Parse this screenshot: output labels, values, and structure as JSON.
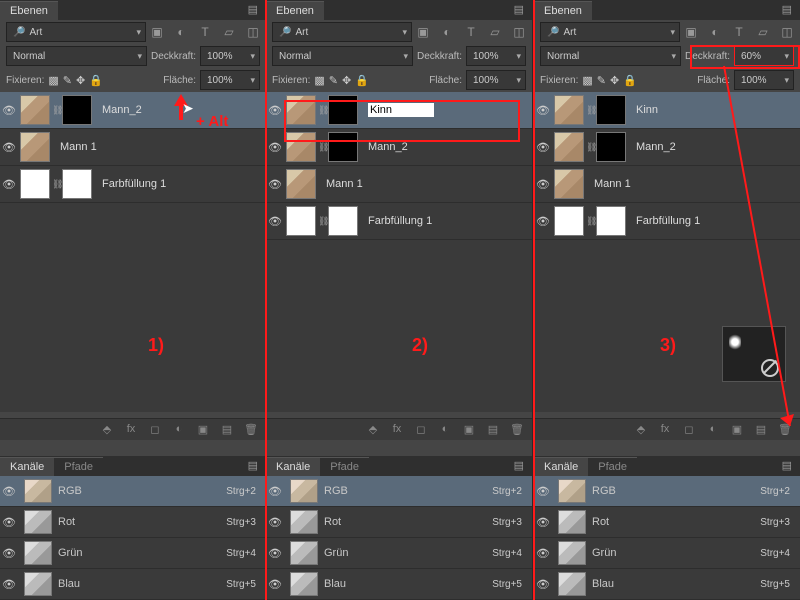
{
  "common": {
    "panelTitle": "Ebenen",
    "filterLabel": "Art",
    "blendMode": "Normal",
    "opacityLabel": "Deckkraft:",
    "fillLabel": "Fläche:",
    "lockLabel": "Fixieren:",
    "pct100": "100%",
    "channelsTab": "Kanäle",
    "pathsTab": "Pfade"
  },
  "panel1": {
    "opacity": "100%",
    "layers": [
      {
        "name": "Mann_2",
        "selected": true,
        "mask": "black"
      },
      {
        "name": "Mann 1",
        "mask": null
      },
      {
        "name": "Farbfüllung 1",
        "fill": true
      }
    ],
    "annoAlt": "+ Alt",
    "annoNum": "1)"
  },
  "panel2": {
    "opacity": "100%",
    "editValue": "Kinn",
    "layers": [
      {
        "name": "__edit__",
        "selected": true,
        "mask": "black"
      },
      {
        "name": "Mann_2",
        "mask": "black"
      },
      {
        "name": "Mann 1",
        "mask": null
      },
      {
        "name": "Farbfüllung 1",
        "fill": true
      }
    ],
    "annoNum": "2)"
  },
  "panel3": {
    "opacity": "60%",
    "layers": [
      {
        "name": "Kinn",
        "selected": true,
        "mask": "black"
      },
      {
        "name": "Mann_2",
        "mask": "black"
      },
      {
        "name": "Mann 1",
        "mask": null
      },
      {
        "name": "Farbfüllung 1",
        "fill": true
      }
    ],
    "annoNum": "3)"
  },
  "channels": [
    {
      "name": "RGB",
      "key": "Strg+2",
      "sel": true,
      "color": true
    },
    {
      "name": "Rot",
      "key": "Strg+3"
    },
    {
      "name": "Grün",
      "key": "Strg+4"
    },
    {
      "name": "Blau",
      "key": "Strg+5"
    }
  ]
}
